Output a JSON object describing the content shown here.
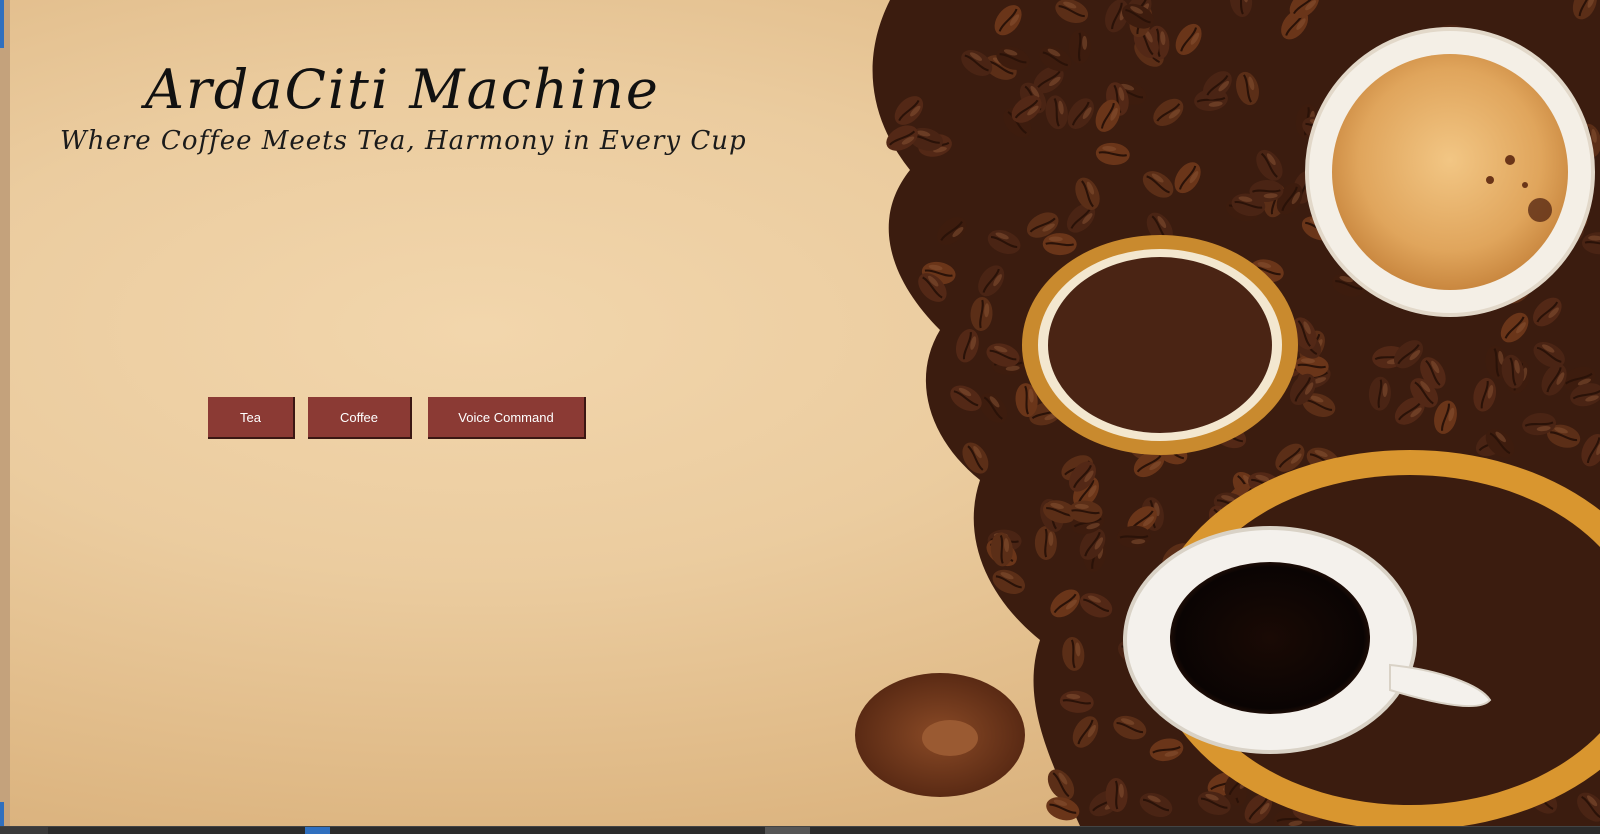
{
  "header": {
    "title": "ArdaCiti Machine",
    "subtitle": "Where Coffee Meets Tea, Harmony in Every Cup"
  },
  "buttons": {
    "tea": "Tea",
    "coffee": "Coffee",
    "voice_command": "Voice Command"
  },
  "colors": {
    "background": "#ebcc9f",
    "button": "#8b3a34",
    "button_text": "#ffffff",
    "coffee_bean": "#4a2414",
    "taskbar": "#2b2b2b"
  },
  "background_image": "coffee-beans-and-cups-image"
}
